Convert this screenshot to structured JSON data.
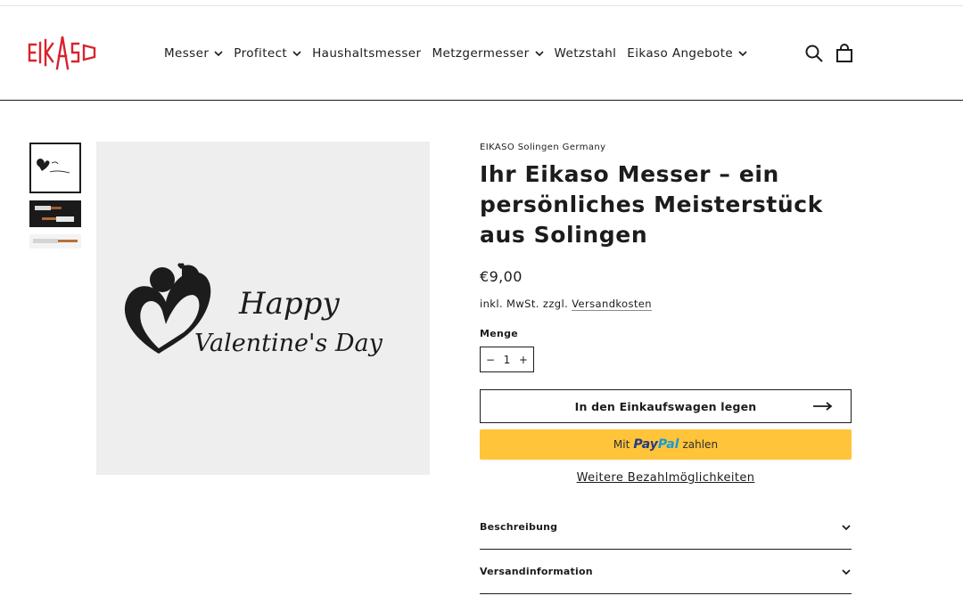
{
  "brand": {
    "name": "EIKASO",
    "color": "#d9232d"
  },
  "header": {
    "nav": [
      {
        "label": "Messer",
        "dropdown": true
      },
      {
        "label": "Profitect",
        "dropdown": true
      },
      {
        "label": "Haushaltsmesser",
        "dropdown": false
      },
      {
        "label": "Metzgermesser",
        "dropdown": true
      },
      {
        "label": "Wetzstahl",
        "dropdown": false
      },
      {
        "label": "Eikaso Angebote",
        "dropdown": true
      }
    ],
    "icons": [
      "search-icon",
      "cart-icon"
    ]
  },
  "gallery": {
    "thumbnails": [
      "valentines-thumbnail",
      "knife-set-thumbnail",
      "knife-thumbnail"
    ],
    "main_image": {
      "line1": "Happy",
      "line2": "Valentine's Day"
    }
  },
  "product": {
    "vendor": "EIKASO Solingen Germany",
    "title": "Ihr Eikaso Messer – ein persönliches Meisterstück aus Solingen",
    "price": "€9,00",
    "tax_prefix": "inkl. MwSt. zzgl.",
    "tax_link": "Versandkosten",
    "quantity_label": "Menge",
    "quantity": "1",
    "minus": "−",
    "plus": "+",
    "add_to_cart": "In den Einkaufswagen legen",
    "paypal_prefix": "Mit",
    "paypal_pay": "Pay",
    "paypal_pal": "Pal",
    "paypal_suffix": "zahlen",
    "paypal_color": "#ffc43a",
    "more_payment": "Weitere Bezahlmöglichkeiten"
  },
  "accordions": [
    {
      "label": "Beschreibung"
    },
    {
      "label": "Versandinformation"
    }
  ]
}
